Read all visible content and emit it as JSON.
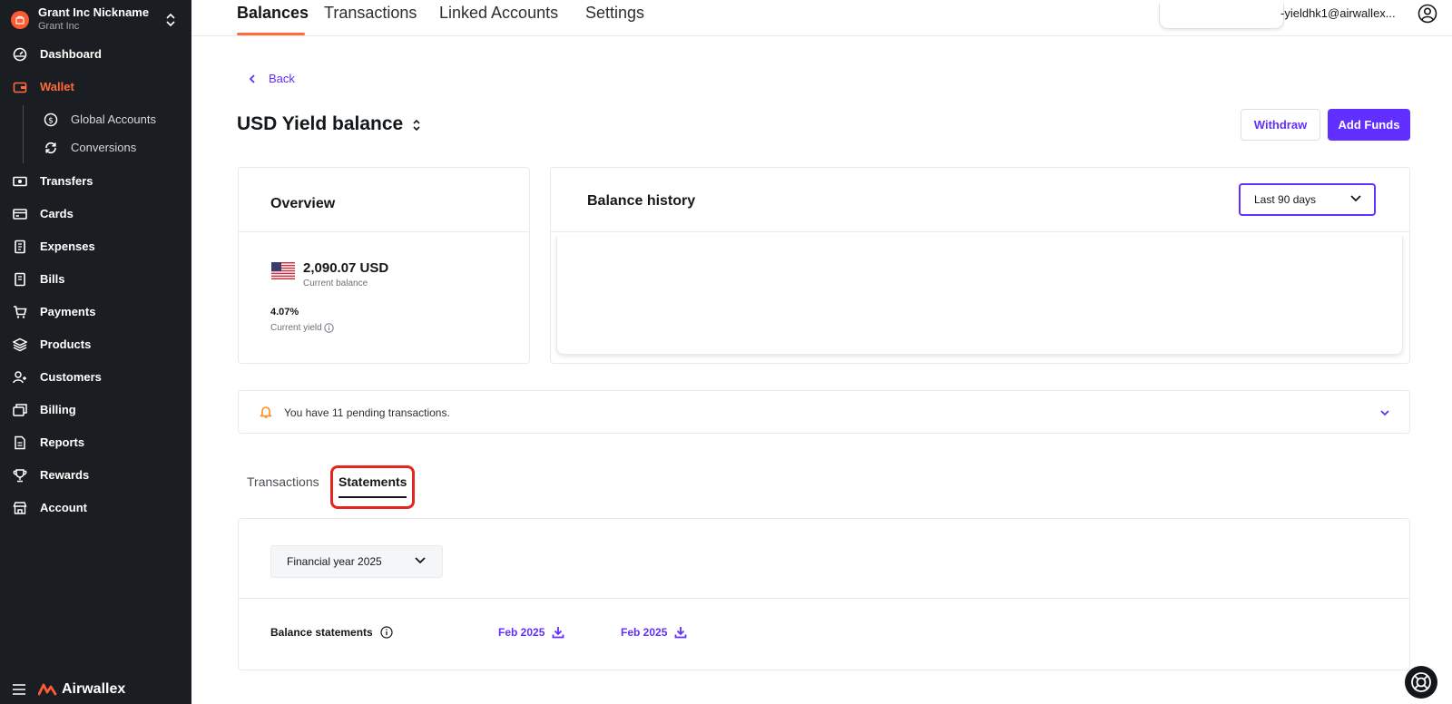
{
  "org": {
    "name": "Grant Inc Nickname",
    "sub": "Grant Inc"
  },
  "nav": {
    "dashboard": "Dashboard",
    "wallet": "Wallet",
    "global_accounts": "Global Accounts",
    "conversions": "Conversions",
    "transfers": "Transfers",
    "cards": "Cards",
    "expenses": "Expenses",
    "bills": "Bills",
    "payments": "Payments",
    "products": "Products",
    "customers": "Customers",
    "billing": "Billing",
    "reports": "Reports",
    "rewards": "Rewards",
    "account": "Account"
  },
  "brand": {
    "name": "Airwallex"
  },
  "topbar": {
    "tabs": [
      "Balances",
      "Transactions",
      "Linked Accounts",
      "Settings"
    ],
    "user_email": "-yieldhk1@airwallex..."
  },
  "main": {
    "back": "Back",
    "title": "USD Yield balance",
    "withdraw": "Withdraw",
    "add_funds": "Add Funds"
  },
  "overview": {
    "title": "Overview",
    "amount": "2,090.07 USD",
    "amount_label": "Current balance",
    "yield": "4.07%",
    "yield_label": "Current yield"
  },
  "history": {
    "title": "Balance history",
    "range": "Last 90 days"
  },
  "pending": {
    "text": "You have 11 pending transactions."
  },
  "tabs": {
    "transactions": "Transactions",
    "statements": "Statements"
  },
  "statements": {
    "year": "Financial year 2025",
    "label": "Balance statements",
    "links": [
      "Feb 2025",
      "Feb 2025"
    ]
  },
  "colors": {
    "accent": "#612fff",
    "brand": "#ff6b3d",
    "highlight": "#e5251e",
    "sidebar": "#1a1d21"
  }
}
